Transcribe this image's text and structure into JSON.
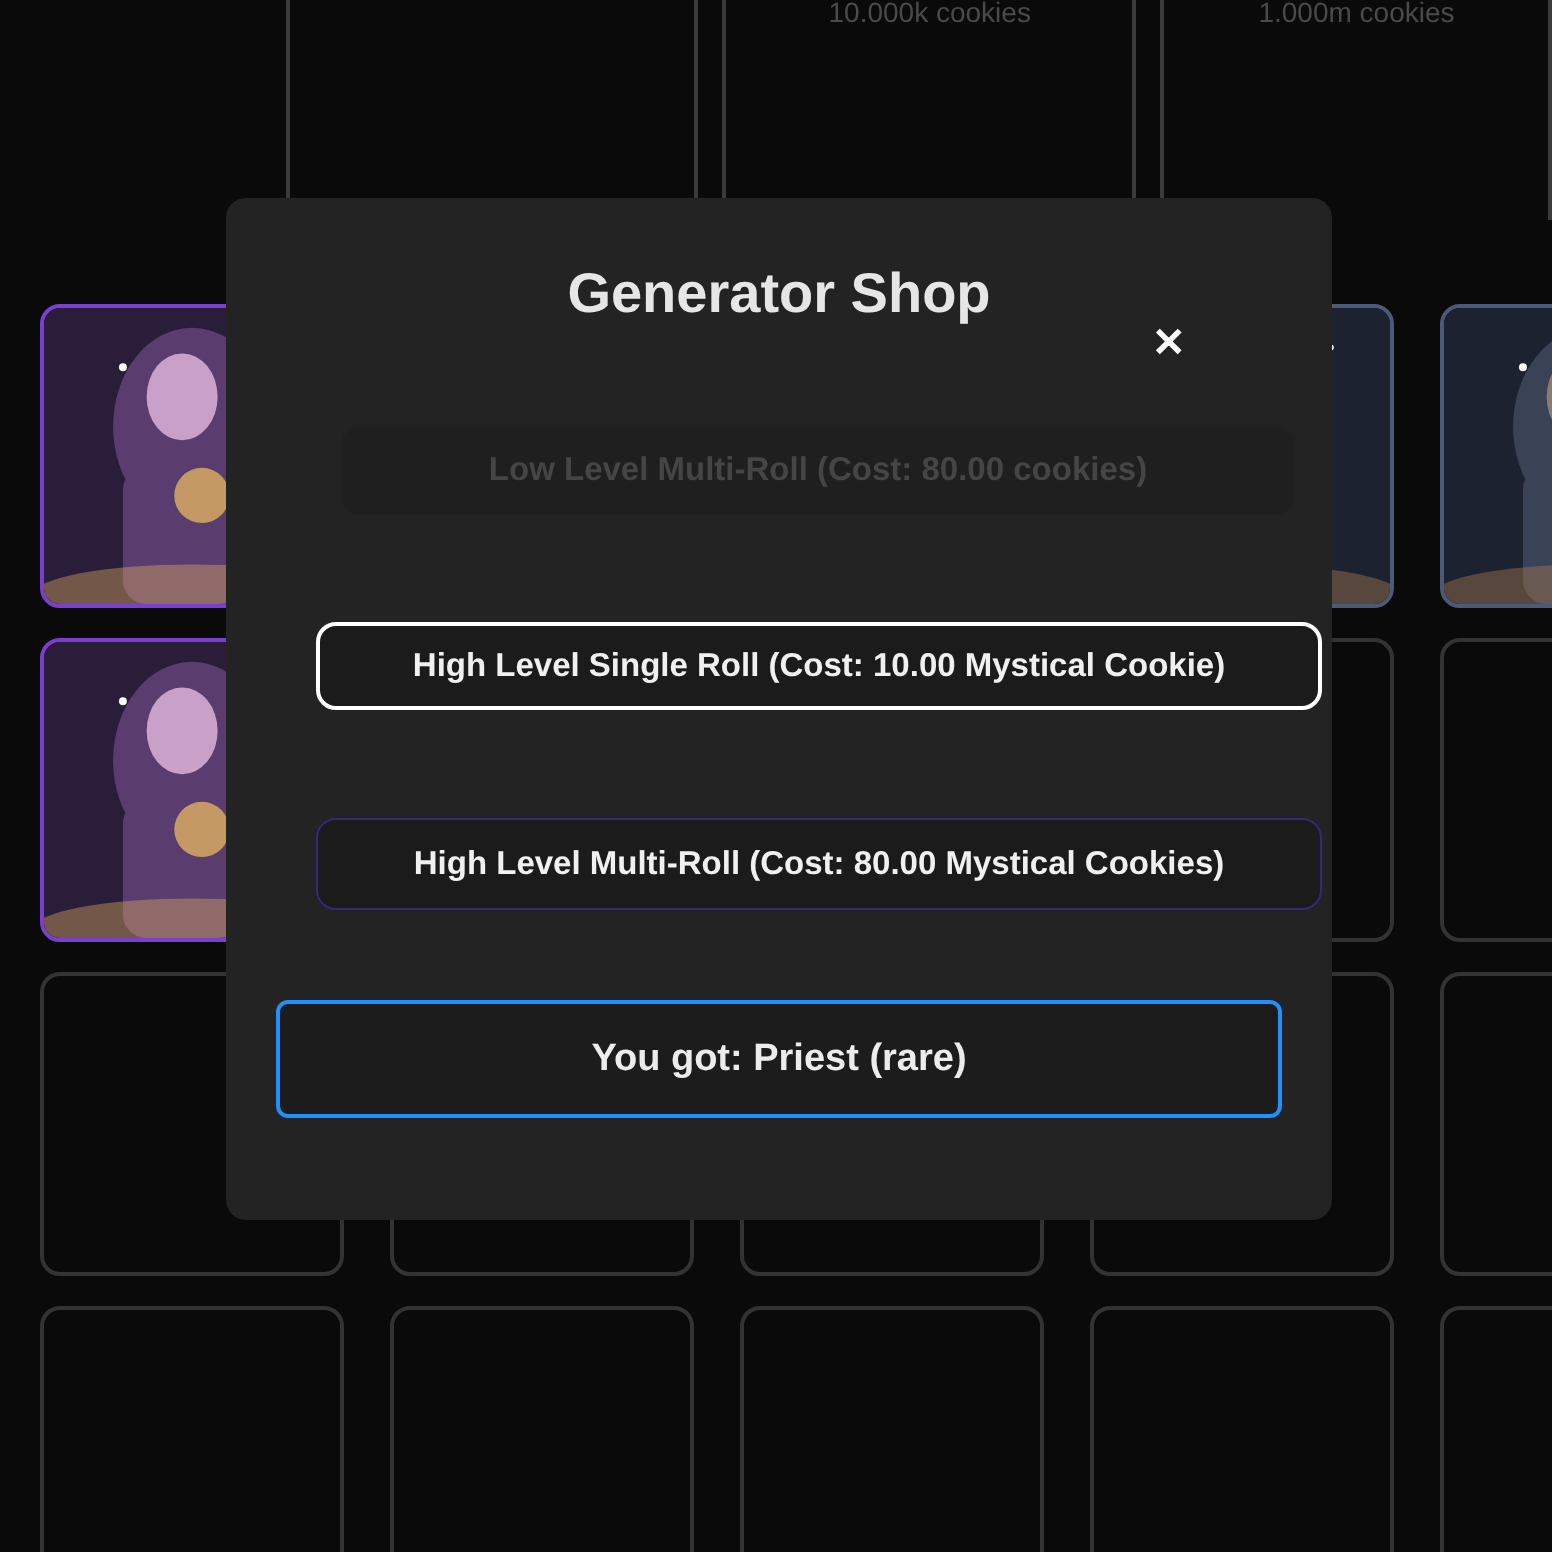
{
  "top_cards": [
    {
      "kind": "blank"
    },
    {
      "kind": "captioned",
      "caption": "10.000k cookies"
    },
    {
      "kind": "captioned",
      "caption": "1.000m cookies"
    }
  ],
  "grid": [
    {
      "kind": "picture",
      "color": "#7b3fd0"
    },
    {
      "kind": "covered"
    },
    {
      "kind": "covered"
    },
    {
      "kind": "picture",
      "color": "#4a5a78"
    },
    {
      "kind": "picture",
      "color": "#4a5a78"
    },
    {
      "kind": "picture",
      "color": "#7b3fd0"
    },
    {
      "kind": "covered"
    },
    {
      "kind": "covered"
    },
    {
      "kind": "empty"
    },
    {
      "kind": "empty"
    },
    {
      "kind": "empty"
    },
    {
      "kind": "empty"
    },
    {
      "kind": "empty"
    },
    {
      "kind": "empty"
    },
    {
      "kind": "empty"
    },
    {
      "kind": "empty"
    },
    {
      "kind": "empty"
    },
    {
      "kind": "empty"
    },
    {
      "kind": "empty"
    },
    {
      "kind": "empty"
    }
  ],
  "modal": {
    "title": "Generator Shop",
    "close": "✕",
    "buttons": [
      {
        "label": "Low Level Multi-Roll (Cost: 80.00 cookies)",
        "disabled": true,
        "focused": false
      },
      {
        "label": "High Level Single Roll (Cost: 10.00 Mystical Cookie)",
        "disabled": false,
        "focused": true
      },
      {
        "label": "High Level Multi-Roll (Cost: 80.00 Mystical Cookies)",
        "disabled": false,
        "focused": false
      }
    ],
    "result": "You got: Priest (rare)"
  }
}
